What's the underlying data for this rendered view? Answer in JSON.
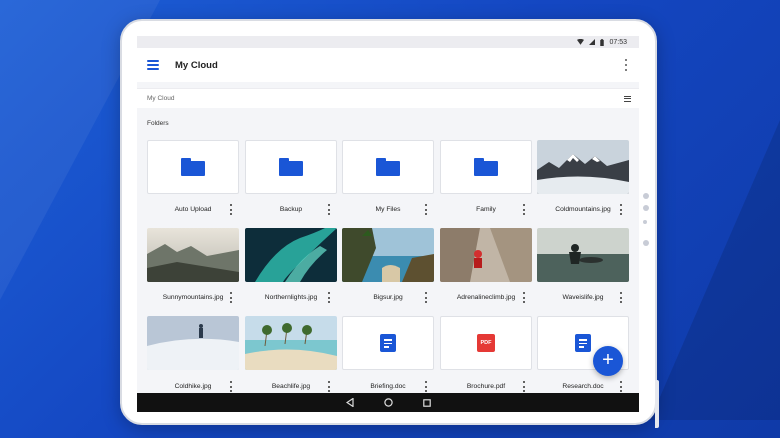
{
  "status_bar": {
    "time": "07:53"
  },
  "app_bar": {
    "title": "My Cloud"
  },
  "breadcrumb": {
    "path": "My Cloud"
  },
  "section": {
    "folders_label": "Folders"
  },
  "items": [
    {
      "name": "Auto Upload",
      "kind": "folder"
    },
    {
      "name": "Backup",
      "kind": "folder"
    },
    {
      "name": "My Files",
      "kind": "folder"
    },
    {
      "name": "Family",
      "kind": "folder"
    },
    {
      "name": "Coldmountains.jpg",
      "kind": "image"
    },
    {
      "name": "Sunnymountains.jpg",
      "kind": "image"
    },
    {
      "name": "Northernlights.jpg",
      "kind": "image"
    },
    {
      "name": "Bigsur.jpg",
      "kind": "image"
    },
    {
      "name": "Adrenalineclimb.jpg",
      "kind": "image"
    },
    {
      "name": "Waveislife.jpg",
      "kind": "image"
    },
    {
      "name": "Coldhike.jpg",
      "kind": "image"
    },
    {
      "name": "Beachlife.jpg",
      "kind": "image"
    },
    {
      "name": "Briefing.doc",
      "kind": "doc"
    },
    {
      "name": "Brochure.pdf",
      "kind": "pdf",
      "badge": "PDF"
    },
    {
      "name": "Research.doc",
      "kind": "doc"
    }
  ],
  "fab": {
    "symbol": "+"
  },
  "colors": {
    "accent": "#1a56d6",
    "background": "#1447c2",
    "pdf_red": "#e53935"
  }
}
